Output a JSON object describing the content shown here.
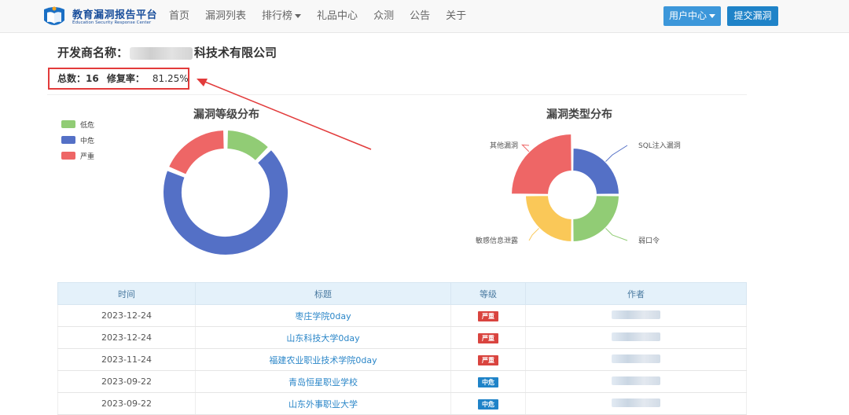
{
  "header": {
    "logo_title": "教育漏洞报告平台",
    "logo_subtitle": "Education Security Response Center",
    "nav": [
      {
        "label": "首页",
        "dropdown": false
      },
      {
        "label": "漏洞列表",
        "dropdown": false
      },
      {
        "label": "排行榜",
        "dropdown": true
      },
      {
        "label": "礼品中心",
        "dropdown": false
      },
      {
        "label": "众测",
        "dropdown": false
      },
      {
        "label": "公告",
        "dropdown": false
      },
      {
        "label": "关于",
        "dropdown": false
      }
    ],
    "user_center_label": "用户中心",
    "submit_label": "提交漏洞"
  },
  "vendor": {
    "label": "开发商名称：",
    "name_suffix": "科技术有限公司",
    "total_label": "总数：",
    "total_value": "16",
    "fix_rate_label": "修复率：",
    "fix_rate_value": "81.25%"
  },
  "colors": {
    "low": "#91cc75",
    "medium": "#5470c6",
    "high": "#ee6666",
    "yellow": "#fac858",
    "accent": "#1f83c8"
  },
  "chart_data": [
    {
      "type": "pie",
      "title": "漏洞等级分布",
      "legend": [
        "低危",
        "中危",
        "严重"
      ],
      "legend_position": "top-left",
      "slices": [
        {
          "name": "低危",
          "value": 2
        },
        {
          "name": "中危",
          "value": 11
        },
        {
          "name": "严重",
          "value": 3
        }
      ]
    },
    {
      "type": "pie",
      "title": "漏洞类型分布",
      "rose": true,
      "slices": [
        {
          "name": "SQL注入漏洞",
          "value": 2
        },
        {
          "name": "弱口令",
          "value": 2
        },
        {
          "name": "敏感信息泄露",
          "value": 2
        },
        {
          "name": "其他漏洞",
          "value": 4
        }
      ]
    }
  ],
  "table": {
    "headers": [
      "时间",
      "标题",
      "等级",
      "作者"
    ],
    "rows": [
      {
        "date": "2023-12-24",
        "title": "枣庄学院0day",
        "level": "严重",
        "level_key": "high"
      },
      {
        "date": "2023-12-24",
        "title": "山东科技大学0day",
        "level": "严重",
        "level_key": "high"
      },
      {
        "date": "2023-11-24",
        "title": "福建农业职业技术学院0day",
        "level": "严重",
        "level_key": "high"
      },
      {
        "date": "2023-09-22",
        "title": "青岛恒星职业学校",
        "level": "中危",
        "level_key": "medium"
      },
      {
        "date": "2023-09-22",
        "title": "山东外事职业大学",
        "level": "中危",
        "level_key": "medium"
      }
    ]
  }
}
